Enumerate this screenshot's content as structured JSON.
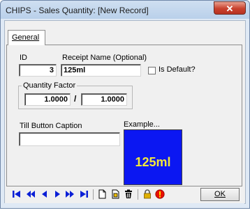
{
  "window": {
    "title": "CHIPS - Sales Quantity: [New Record]",
    "close_glyph": "✕"
  },
  "tabs": [
    {
      "label": "General"
    }
  ],
  "form": {
    "id_label": "ID",
    "id_value": "3",
    "receipt_label": "Receipt Name (Optional)",
    "receipt_value": "125ml",
    "is_default_label": "Is Default?",
    "is_default_checked": false,
    "quantity_group_label": "Quantity Factor",
    "qty_numerator": "1.0000",
    "qty_separator": "/",
    "qty_denominator": "1.0000",
    "till_caption_label": "Till Button Caption",
    "till_caption_value": "",
    "example_label": "Example...",
    "example_text": "125ml",
    "example_bg": "#0b17f2",
    "example_fg": "#f4e93a"
  },
  "toolbar": {
    "buttons": [
      "first-record-icon",
      "prev-page-icon",
      "prev-record-icon",
      "next-record-icon",
      "next-page-icon",
      "last-record-icon",
      "new-record-icon",
      "copy-record-icon",
      "delete-icon",
      "lock-icon",
      "warning-icon"
    ],
    "ok_label": "OK",
    "nav_color": "#0a1fd6"
  }
}
